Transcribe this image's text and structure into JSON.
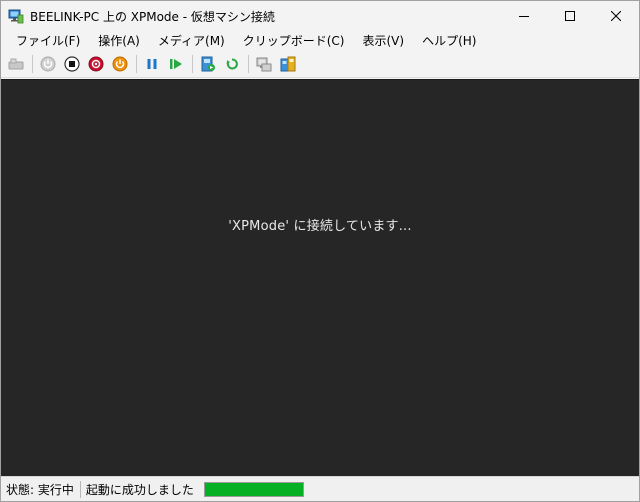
{
  "window": {
    "title": "BEELINK-PC 上の XPMode  - 仮想マシン接続"
  },
  "menu": [
    {
      "label": "ファイル(F)"
    },
    {
      "label": "操作(A)"
    },
    {
      "label": "メディア(M)"
    },
    {
      "label": "クリップボード(C)"
    },
    {
      "label": "表示(V)"
    },
    {
      "label": "ヘルプ(H)"
    }
  ],
  "screen": {
    "message": "'XPMode' に接続しています..."
  },
  "status": {
    "state": "状態: 実行中",
    "message": "起動に成功しました",
    "progress": 1.0
  },
  "colors": {
    "progress": "#06b025",
    "screen_bg": "#262626"
  },
  "toolbar_icons": [
    "ctrl-alt-del-icon",
    "start-icon",
    "turn-off-icon",
    "shutdown-icon",
    "power-icon",
    "pause-icon",
    "resume-icon",
    "checkpoint-icon",
    "revert-icon",
    "enhanced-session-icon",
    "share-icon"
  ]
}
